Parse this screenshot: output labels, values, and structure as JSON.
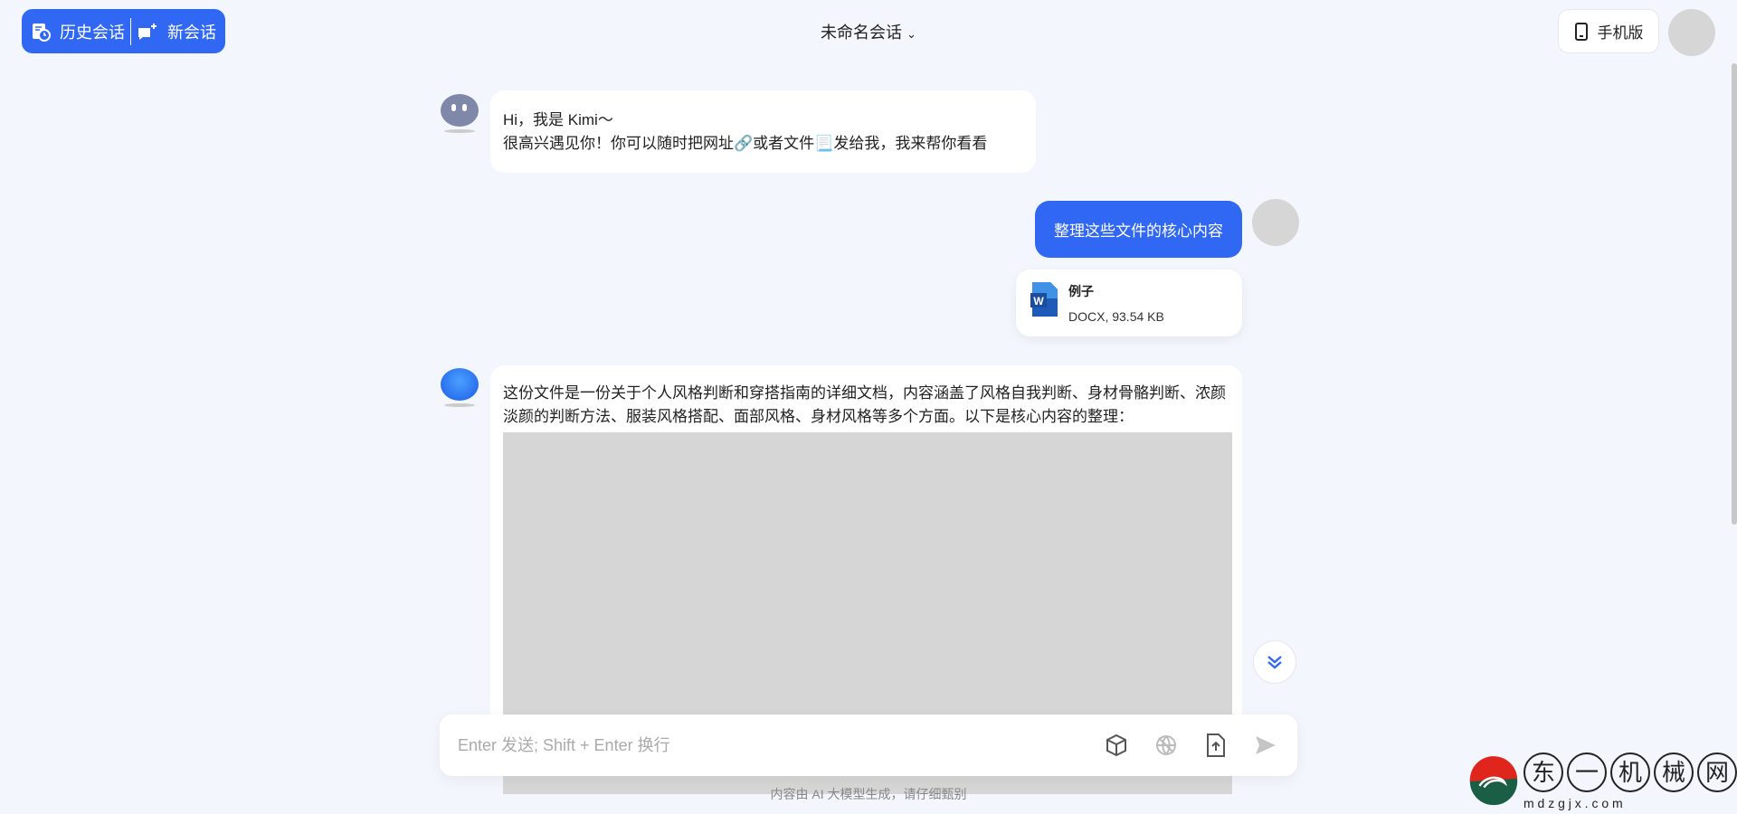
{
  "header": {
    "history_label": "历史会话",
    "new_chat_label": "新会话",
    "title": "未命名会话",
    "mobile_label": "手机版"
  },
  "messages": [
    {
      "role": "assistant",
      "lines": [
        "Hi，我是 Kimi～",
        "很高兴遇见你！你可以随时把网址🔗或者文件📃发给我，我来帮你看看"
      ]
    },
    {
      "role": "user",
      "text": "整理这些文件的核心内容",
      "file": {
        "name": "例子",
        "meta": "DOCX, 93.54 KB",
        "icon": "word-file-icon"
      }
    },
    {
      "role": "assistant",
      "text": "这份文件是一份关于个人风格判断和穿搭指南的详细文档，内容涵盖了风格自我判断、身材骨骼判断、浓颜淡颜的判断方法、服装风格搭配、面部风格、身材风格等多个方面。以下是核心内容的整理："
    }
  ],
  "input": {
    "placeholder": "Enter 发送; Shift + Enter 换行",
    "tools": [
      "cube-icon",
      "globe-icon",
      "upload-file-icon",
      "send-icon"
    ]
  },
  "footer": "内容由 AI 大模型生成，请仔细甄别",
  "watermark": {
    "chars": "东一机械网",
    "domain": "m d z g j x . c o m"
  },
  "colors": {
    "accent": "#3168f3",
    "background": "#f3f6fc"
  }
}
